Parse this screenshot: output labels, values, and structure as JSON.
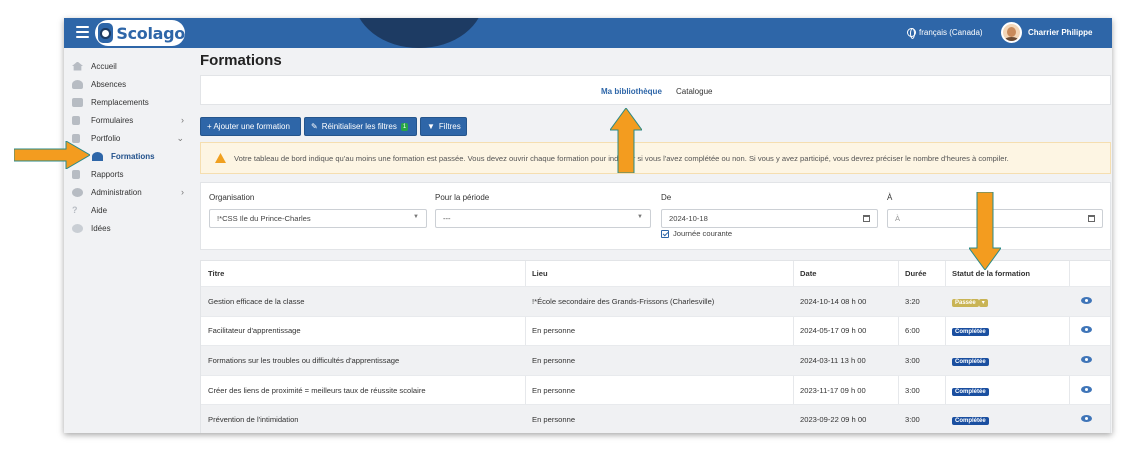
{
  "header": {
    "app_name": "Scolago",
    "language": "français (Canada)",
    "user_name": "Charrier Philippe"
  },
  "sidebar": {
    "items": [
      {
        "label": "Accueil",
        "icon": "home-icon"
      },
      {
        "label": "Absences",
        "icon": "person-icon"
      },
      {
        "label": "Remplacements",
        "icon": "pencil-icon"
      },
      {
        "label": "Formulaires",
        "icon": "document-icon",
        "expandable": true
      },
      {
        "label": "Portfolio",
        "icon": "portfolio-icon",
        "expanded": true
      },
      {
        "label": "Formations",
        "icon": "graduation-cap-icon",
        "active": true
      },
      {
        "label": "Rapports",
        "icon": "report-icon"
      },
      {
        "label": "Administration",
        "icon": "gear-icon",
        "expandable": true
      },
      {
        "label": "Aide",
        "icon": "question-icon"
      },
      {
        "label": "Idées",
        "icon": "lightbulb-icon"
      }
    ]
  },
  "main": {
    "title": "Formations",
    "tabs": [
      {
        "label": "Ma bibliothèque",
        "active": true
      },
      {
        "label": "Catalogue",
        "active": false
      }
    ],
    "buttons": {
      "add": "+ Ajouter une formation",
      "reset": "Réinitialiser les filtres",
      "reset_count": "1",
      "filters": "Filtres"
    },
    "alert": "Votre tableau de bord indique qu'au moins une formation est passée. Vous devez ouvrir chaque formation pour indiquer si vous l'avez complétée ou non. Si vous y avez participé, vous devrez préciser le nombre d'heures à compiler.",
    "filters": {
      "organisation_label": "Organisation",
      "organisation_value": "!*CSS Ile du Prince-Charles",
      "period_label": "Pour la période",
      "period_value": "---",
      "from_label": "De",
      "from_value": "2024-10-18",
      "to_label": "À",
      "to_placeholder": "À",
      "current_day_label": "Journée courante",
      "current_day_checked": true
    },
    "table": {
      "headers": [
        "Titre",
        "Lieu",
        "Date",
        "Durée",
        "Statut de la formation",
        ""
      ],
      "rows": [
        {
          "titre": "Gestion efficace de la classe",
          "lieu": "!*École secondaire des Grands-Frissons (Charlesville)",
          "date": "2024-10-14 08 h 00",
          "duree": "3:20",
          "statut": "Passée"
        },
        {
          "titre": "Facilitateur d'apprentissage",
          "lieu": "En personne",
          "date": "2024-05-17 09 h 00",
          "duree": "6:00",
          "statut": "Complétée"
        },
        {
          "titre": "Formations sur les troubles ou difficultés d'apprentissage",
          "lieu": "En personne",
          "date": "2024-03-11 13 h 00",
          "duree": "3:00",
          "statut": "Complétée"
        },
        {
          "titre": "Créer des liens de proximité = meilleurs taux de réussite scolaire",
          "lieu": "En personne",
          "date": "2023-11-17 09 h 00",
          "duree": "3:00",
          "statut": "Complétée"
        },
        {
          "titre": "Prévention de l'intimidation",
          "lieu": "En personne",
          "date": "2023-09-22 09 h 00",
          "duree": "3:00",
          "statut": "Complétée"
        }
      ]
    }
  },
  "colors": {
    "brand": "#2e66a8",
    "arrow": "#f39c1f",
    "status_done": "#1a4fa0",
    "status_past": "#c9b455"
  }
}
